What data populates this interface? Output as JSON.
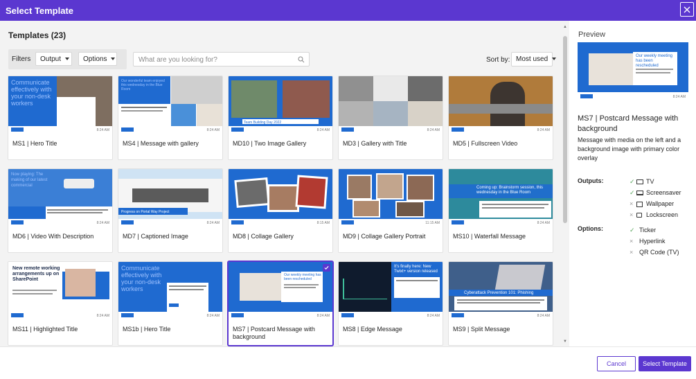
{
  "dialog": {
    "title": "Select Template"
  },
  "templates": {
    "heading": "Templates (23)",
    "filters_label": "Filters",
    "output_dropdown": "Output",
    "options_dropdown": "Options",
    "search_placeholder": "What are you looking for?",
    "sort_label": "Sort by:",
    "sort_value": "Most used",
    "cards": [
      {
        "caption": "MS1 | Hero Title",
        "time": "8:24 AM",
        "thumb_text": "Communicate effectively with your non-desk workers"
      },
      {
        "caption": "MS4 | Message with gallery",
        "time": "8:24 AM",
        "thumb_text": "Our wonderful team enjoyed this wednesday in the Blue Room"
      },
      {
        "caption": "MD10 | Two Image Gallery",
        "time": "8:24 AM",
        "thumb_text": "Team Building Day 2022"
      },
      {
        "caption": "MD3 | Gallery with Title",
        "time": "8:24 AM",
        "thumb_text": ""
      },
      {
        "caption": "MD5 | Fullscreen Video",
        "time": "8:24 AM",
        "thumb_text": ""
      },
      {
        "caption": "MD6 | Video With Description",
        "time": "8:24 AM",
        "thumb_text": "Now playing: The making of our latest commercial"
      },
      {
        "caption": "MD7 | Captioned Image",
        "time": "8:24 AM",
        "thumb_text": "Progress on Portal Way Project"
      },
      {
        "caption": "MD8 | Collage Gallery",
        "time": "8:15 AM",
        "thumb_text": ""
      },
      {
        "caption": "MD9 | Collage Gallery Portrait",
        "time": "11:15 AM",
        "thumb_text": ""
      },
      {
        "caption": "MS10 | Waterfall Message",
        "time": "8:24 AM",
        "thumb_text": "Coming up: Brainstorm session, this wednesday in the Blue Room"
      },
      {
        "caption": "MS11 | Highlighted Title",
        "time": "8:24 AM",
        "thumb_text": "New remote working arrangements up on SharePoint"
      },
      {
        "caption": "MS1b | Hero Title",
        "time": "8:24 AM",
        "thumb_text": "Communicate effectively with your non-desk workers"
      },
      {
        "caption": "MS7 | Postcard Message with background",
        "time": "8:24 AM",
        "thumb_text": "Our weekly meeting has been rescheduled"
      },
      {
        "caption": "MS8 | Edge Message",
        "time": "8:24 AM",
        "thumb_text": "It's finally here: New Twixt+ version released"
      },
      {
        "caption": "MS9 | Split Message",
        "time": "8:24 AM",
        "thumb_text": "Cyberattack Prevention 101: Phishing"
      }
    ]
  },
  "preview": {
    "heading": "Preview",
    "title": "MS7 | Postcard Message with background",
    "description": "Message with media on the left and a background image with primary color overlay",
    "thumb_time": "8:24 AM",
    "thumb_text": "Our weekly meeting has been rescheduled",
    "outputs_label": "Outputs:",
    "outputs": [
      {
        "mark": "✓",
        "icon": "tv-icon",
        "label": "TV"
      },
      {
        "mark": "✓",
        "icon": "screensaver-icon",
        "label": "Screensaver"
      },
      {
        "mark": "×",
        "icon": "wallpaper-icon",
        "label": "Wallpaper"
      },
      {
        "mark": "×",
        "icon": "lockscreen-icon",
        "label": "Lockscreen"
      }
    ],
    "options_label": "Options:",
    "options": [
      {
        "mark": "✓",
        "label": "Ticker"
      },
      {
        "mark": "×",
        "label": "Hyperlink"
      },
      {
        "mark": "×",
        "label": "QR Code (TV)"
      }
    ]
  },
  "footer": {
    "cancel": "Cancel",
    "select": "Select Template"
  },
  "colors": {
    "accent": "#5b37d0",
    "brand_blue": "#1f6ad0",
    "check": "#57a55a"
  }
}
